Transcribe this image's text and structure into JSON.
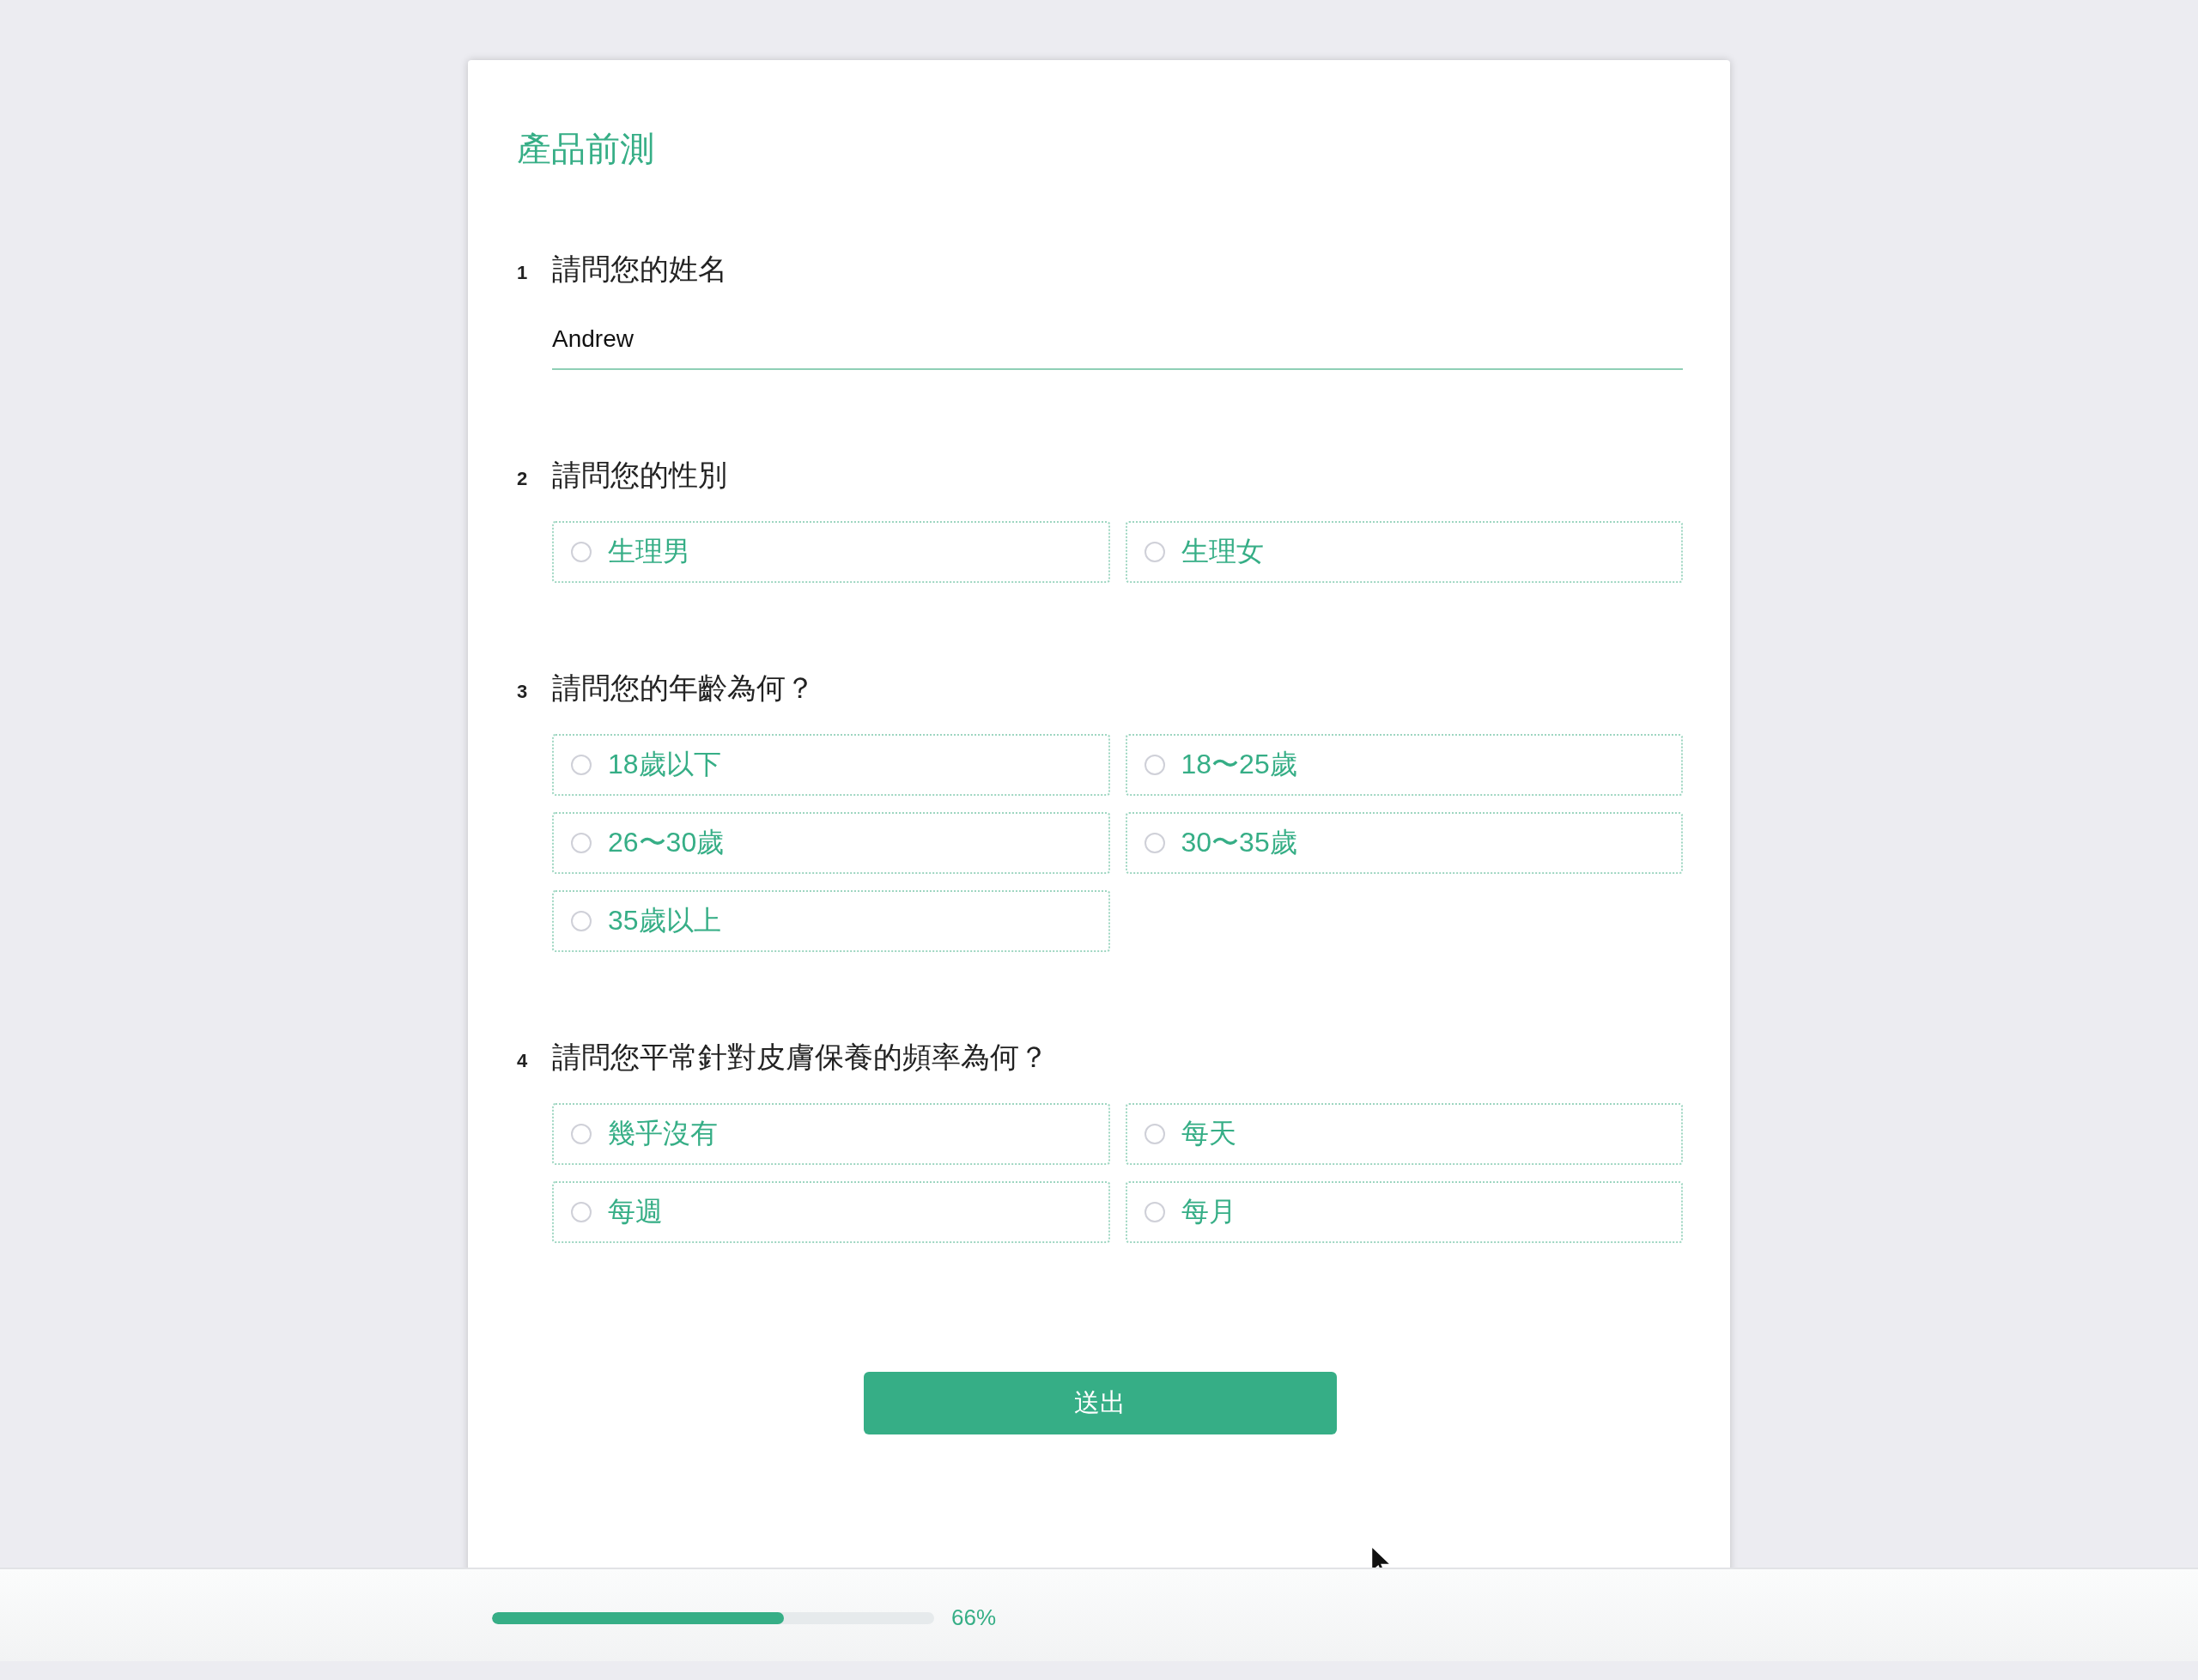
{
  "form": {
    "title": "產品前測",
    "questions": [
      {
        "number": "1",
        "kind": "text",
        "label": "請問您的姓名",
        "value": "Andrew"
      },
      {
        "number": "2",
        "kind": "choice",
        "label": "請問您的性別",
        "options": [
          {
            "label": "生理男",
            "selected": false
          },
          {
            "label": "生理女",
            "selected": false
          }
        ]
      },
      {
        "number": "3",
        "kind": "choice",
        "label": "請問您的年齡為何？",
        "options": [
          {
            "label": "18歲以下",
            "selected": false
          },
          {
            "label": "18〜25歲",
            "selected": false
          },
          {
            "label": "26〜30歲",
            "selected": false
          },
          {
            "label": "30〜35歲",
            "selected": false
          },
          {
            "label": "35歲以上",
            "selected": false
          }
        ]
      },
      {
        "number": "4",
        "kind": "choice",
        "label": "請問您平常針對皮膚保養的頻率為何？",
        "options": [
          {
            "label": "幾乎沒有",
            "selected": false
          },
          {
            "label": "每天",
            "selected": false
          },
          {
            "label": "每週",
            "selected": false
          },
          {
            "label": "每月",
            "selected": false
          }
        ]
      }
    ],
    "submit_button": "送出"
  },
  "progress": {
    "level": 0.66,
    "reading": "66%"
  }
}
